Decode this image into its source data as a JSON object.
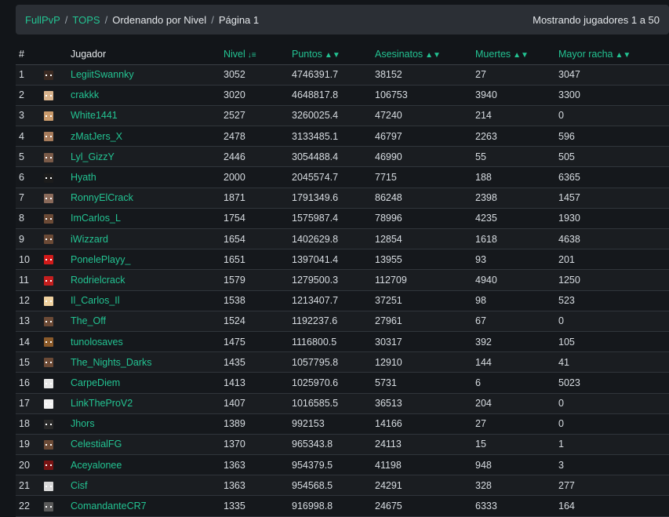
{
  "breadcrumb": {
    "site": "FullPvP",
    "section": "TOPS",
    "sort": "Ordenando por Nivel",
    "page": "Página 1",
    "separator": "/"
  },
  "showing": "Mostrando jugadores 1 a 50",
  "table": {
    "headers": {
      "rank": "#",
      "player": "Jugador",
      "level": "Nivel",
      "points": "Puntos",
      "kills": "Asesinatos",
      "deaths": "Muertes",
      "streak": "Mayor racha"
    },
    "rows": [
      {
        "rank": "1",
        "name": "LegiitSwannky",
        "level": "3052",
        "points": "4746391.7",
        "kills": "38152",
        "deaths": "27",
        "streak": "3047",
        "avatar_color": "#3b2a22"
      },
      {
        "rank": "2",
        "name": "crakkk",
        "level": "3020",
        "points": "4648817.8",
        "kills": "106753",
        "deaths": "3940",
        "streak": "3300",
        "avatar_color": "#d9b38c"
      },
      {
        "rank": "3",
        "name": "White1441",
        "level": "2527",
        "points": "3260025.4",
        "kills": "47240",
        "deaths": "214",
        "streak": "0",
        "avatar_color": "#c99a6b"
      },
      {
        "rank": "4",
        "name": "zMatJers_X",
        "level": "2478",
        "points": "3133485.1",
        "kills": "46797",
        "deaths": "2263",
        "streak": "596",
        "avatar_color": "#a67b5b"
      },
      {
        "rank": "5",
        "name": "Lyl_GizzY",
        "level": "2446",
        "points": "3054488.4",
        "kills": "46990",
        "deaths": "55",
        "streak": "505",
        "avatar_color": "#7a5a48"
      },
      {
        "rank": "6",
        "name": "Hyath",
        "level": "2000",
        "points": "2045574.7",
        "kills": "7715",
        "deaths": "188",
        "streak": "6365",
        "avatar_color": "#1c1c1c"
      },
      {
        "rank": "7",
        "name": "RonnyElCrack",
        "level": "1871",
        "points": "1791349.6",
        "kills": "86248",
        "deaths": "2398",
        "streak": "1457",
        "avatar_color": "#8a6a5a"
      },
      {
        "rank": "8",
        "name": "ImCarlos_L",
        "level": "1754",
        "points": "1575987.4",
        "kills": "78996",
        "deaths": "4235",
        "streak": "1930",
        "avatar_color": "#6b4a36"
      },
      {
        "rank": "9",
        "name": "iWizzard",
        "level": "1654",
        "points": "1402629.8",
        "kills": "12854",
        "deaths": "1618",
        "streak": "4638",
        "avatar_color": "#6b4a36"
      },
      {
        "rank": "10",
        "name": "PonelePlayy_",
        "level": "1651",
        "points": "1397041.4",
        "kills": "13955",
        "deaths": "93",
        "streak": "201",
        "avatar_color": "#d11a1a"
      },
      {
        "rank": "11",
        "name": "Rodrielcrack",
        "level": "1579",
        "points": "1279500.3",
        "kills": "112709",
        "deaths": "4940",
        "streak": "1250",
        "avatar_color": "#c41e1e"
      },
      {
        "rank": "12",
        "name": "Il_Carlos_Il",
        "level": "1538",
        "points": "1213407.7",
        "kills": "37251",
        "deaths": "98",
        "streak": "523",
        "avatar_color": "#f0d2a0"
      },
      {
        "rank": "13",
        "name": "The_Off",
        "level": "1524",
        "points": "1192237.6",
        "kills": "27961",
        "deaths": "67",
        "streak": "0",
        "avatar_color": "#6b4a36"
      },
      {
        "rank": "14",
        "name": "tunolosaves",
        "level": "1475",
        "points": "1116800.5",
        "kills": "30317",
        "deaths": "392",
        "streak": "105",
        "avatar_color": "#8a5a2a"
      },
      {
        "rank": "15",
        "name": "The_Nights_Darks",
        "level": "1435",
        "points": "1057795.8",
        "kills": "12910",
        "deaths": "144",
        "streak": "41",
        "avatar_color": "#6b4a36"
      },
      {
        "rank": "16",
        "name": "CarpeDiem",
        "level": "1413",
        "points": "1025970.6",
        "kills": "5731",
        "deaths": "6",
        "streak": "5023",
        "avatar_color": "#e8e8e8"
      },
      {
        "rank": "17",
        "name": "LinkTheProV2",
        "level": "1407",
        "points": "1016585.5",
        "kills": "36513",
        "deaths": "204",
        "streak": "0",
        "avatar_color": "#f2f2f2"
      },
      {
        "rank": "18",
        "name": "Jhors",
        "level": "1389",
        "points": "992153",
        "kills": "14166",
        "deaths": "27",
        "streak": "0",
        "avatar_color": "#2a2a2a"
      },
      {
        "rank": "19",
        "name": "CelestialFG",
        "level": "1370",
        "points": "965343.8",
        "kills": "24113",
        "deaths": "15",
        "streak": "1",
        "avatar_color": "#6b4a36"
      },
      {
        "rank": "20",
        "name": "Aceyalonee",
        "level": "1363",
        "points": "954379.5",
        "kills": "41198",
        "deaths": "948",
        "streak": "3",
        "avatar_color": "#7a1414"
      },
      {
        "rank": "21",
        "name": "Cisf",
        "level": "1363",
        "points": "954568.5",
        "kills": "24291",
        "deaths": "328",
        "streak": "277",
        "avatar_color": "#d8d8d8"
      },
      {
        "rank": "22",
        "name": "ComandanteCR7",
        "level": "1335",
        "points": "916998.8",
        "kills": "24675",
        "deaths": "6333",
        "streak": "164",
        "avatar_color": "#5a5a5a"
      }
    ]
  },
  "colors": {
    "accent": "#23c392",
    "background": "#121519",
    "bar": "#2b2f35"
  }
}
